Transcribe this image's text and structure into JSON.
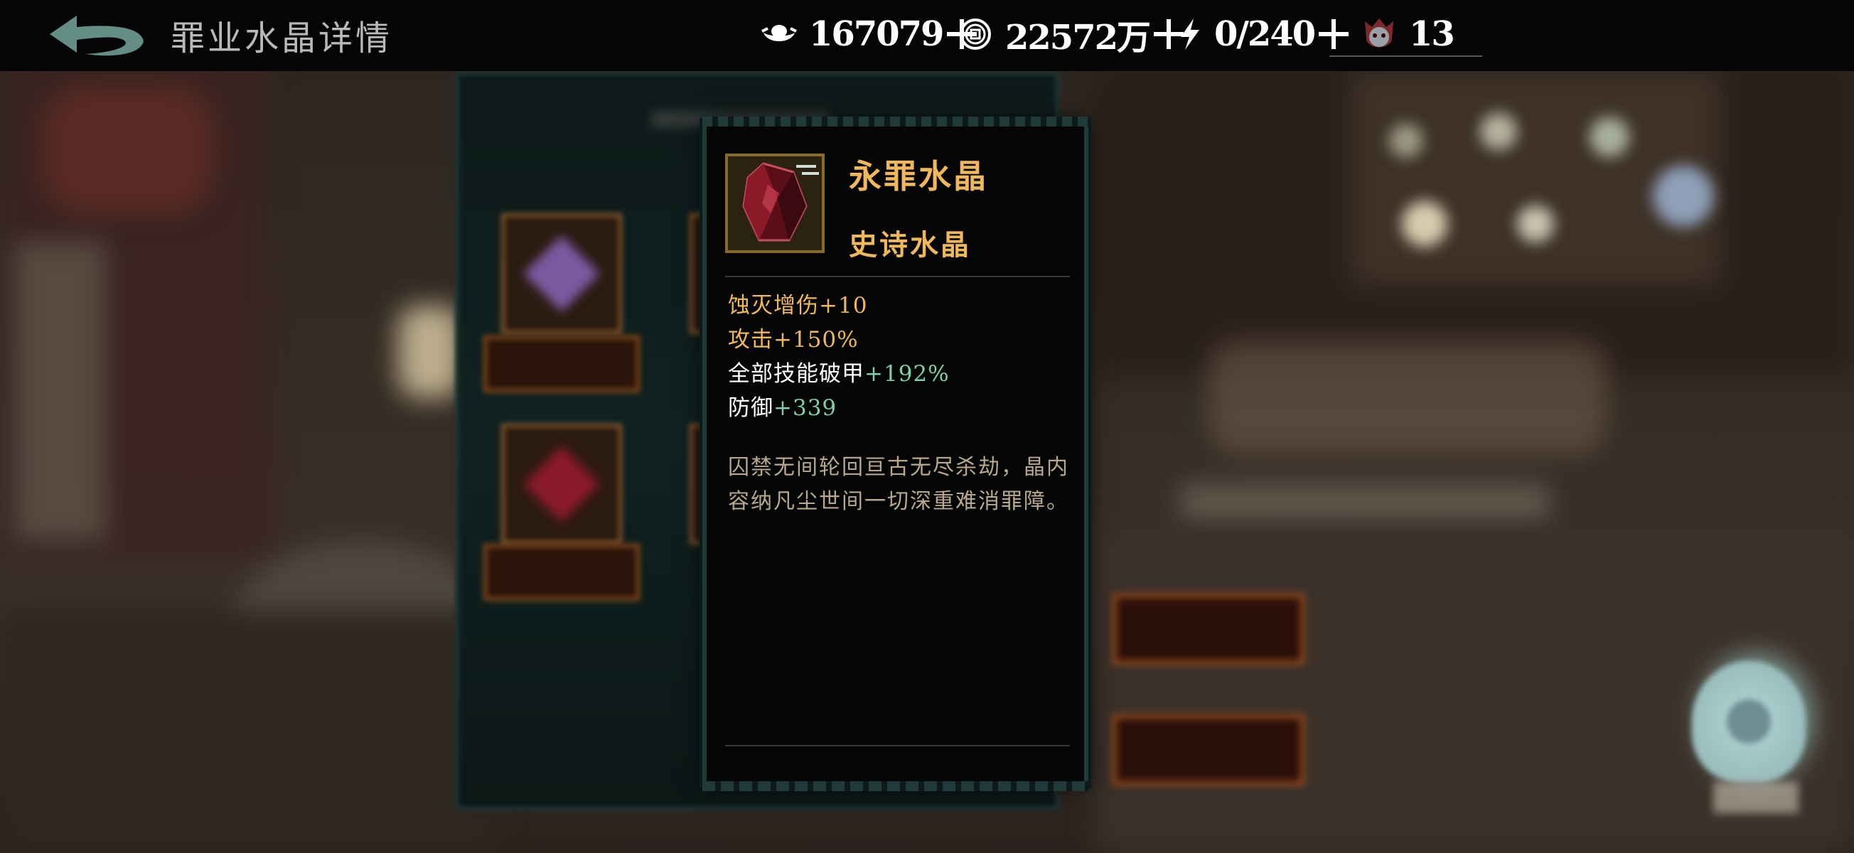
{
  "header": {
    "title": "罪业水晶详情",
    "back_icon": "back-arrow-icon"
  },
  "resources": [
    {
      "icon": "silver-ingot-icon",
      "value": "167079"
    },
    {
      "icon": "copper-coin-icon",
      "value": "22572万"
    },
    {
      "icon": "lightning-stamina-icon",
      "value": "0/240"
    },
    {
      "icon": "demon-mask-icon",
      "value": "13"
    }
  ],
  "crystal_detail": {
    "name": "永罪水晶",
    "rarity": "史诗水晶",
    "stats": [
      {
        "name": "蚀灭增伤",
        "value": "+10",
        "highlight": "gold"
      },
      {
        "name": "攻击",
        "value": "+150%",
        "highlight": "gold"
      },
      {
        "name": "全部技能破甲",
        "value": "+192%",
        "highlight": "green"
      },
      {
        "name": "防御",
        "value": "+339",
        "highlight": "green"
      }
    ],
    "description": "囚禁无间轮回亘古无尽杀劫，晶内容纳凡尘世间一切深重难消罪障。"
  },
  "colors": {
    "gold": "#f0b85a",
    "green": "#7fd0a8",
    "description": "#b9a88a",
    "panel_border": "#1f3a38"
  }
}
